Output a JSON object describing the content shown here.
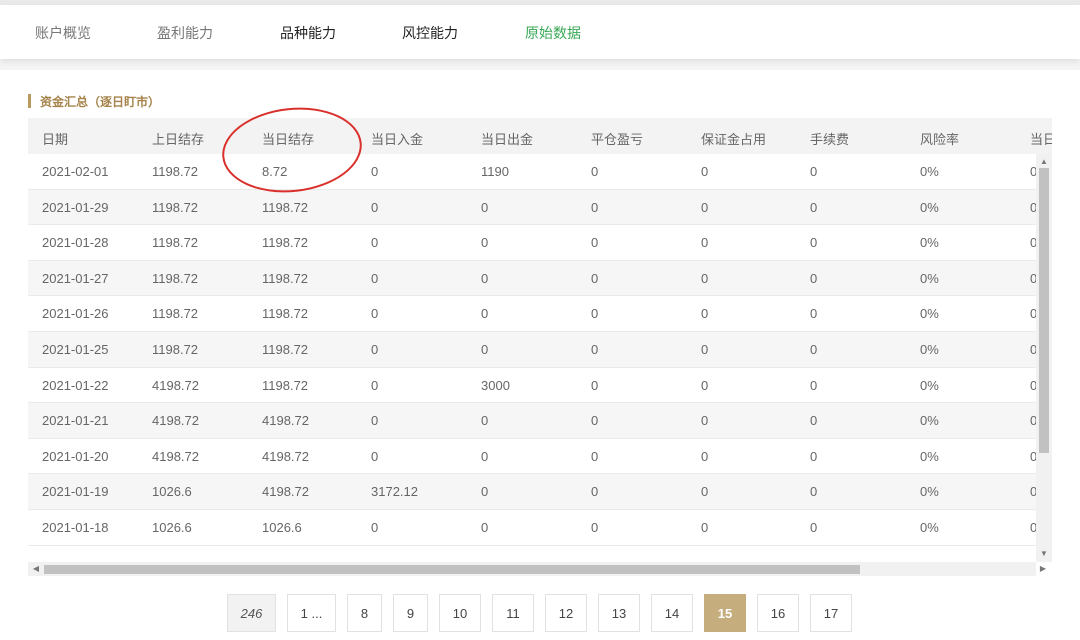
{
  "nav": {
    "tabs": [
      {
        "label": "账户概览",
        "state": "gray"
      },
      {
        "label": "盈利能力",
        "state": "gray"
      },
      {
        "label": "品种能力",
        "state": "dark"
      },
      {
        "label": "风控能力",
        "state": "dark"
      },
      {
        "label": "原始数据",
        "state": "active"
      }
    ]
  },
  "section": {
    "title": "资金汇总（逐日盯市）"
  },
  "table": {
    "headers": [
      "日期",
      "上日结存",
      "当日结存",
      "当日入金",
      "当日出金",
      "平仓盈亏",
      "保证金占用",
      "手续费",
      "风险率",
      "当日"
    ],
    "rows": [
      [
        "2021-02-01",
        "1198.72",
        "8.72",
        "0",
        "1190",
        "0",
        "0",
        "0",
        "0%",
        "0"
      ],
      [
        "2021-01-29",
        "1198.72",
        "1198.72",
        "0",
        "0",
        "0",
        "0",
        "0",
        "0%",
        "0"
      ],
      [
        "2021-01-28",
        "1198.72",
        "1198.72",
        "0",
        "0",
        "0",
        "0",
        "0",
        "0%",
        "0"
      ],
      [
        "2021-01-27",
        "1198.72",
        "1198.72",
        "0",
        "0",
        "0",
        "0",
        "0",
        "0%",
        "0"
      ],
      [
        "2021-01-26",
        "1198.72",
        "1198.72",
        "0",
        "0",
        "0",
        "0",
        "0",
        "0%",
        "0"
      ],
      [
        "2021-01-25",
        "1198.72",
        "1198.72",
        "0",
        "0",
        "0",
        "0",
        "0",
        "0%",
        "0"
      ],
      [
        "2021-01-22",
        "4198.72",
        "1198.72",
        "0",
        "3000",
        "0",
        "0",
        "0",
        "0%",
        "0"
      ],
      [
        "2021-01-21",
        "4198.72",
        "4198.72",
        "0",
        "0",
        "0",
        "0",
        "0",
        "0%",
        "0"
      ],
      [
        "2021-01-20",
        "4198.72",
        "4198.72",
        "0",
        "0",
        "0",
        "0",
        "0",
        "0%",
        "0"
      ],
      [
        "2021-01-19",
        "1026.6",
        "4198.72",
        "3172.12",
        "0",
        "0",
        "0",
        "0",
        "0%",
        "0"
      ],
      [
        "2021-01-18",
        "1026.6",
        "1026.6",
        "0",
        "0",
        "0",
        "0",
        "0",
        "0%",
        "0"
      ]
    ]
  },
  "pagination": {
    "total": "246",
    "pages": [
      "1 ...",
      "8",
      "9",
      "10",
      "11",
      "12",
      "13",
      "14",
      "15",
      "16",
      "17"
    ],
    "current": "15"
  },
  "colors": {
    "accent_gold": "#c5ad7e",
    "active_tab": "#3aa856",
    "annotation_red": "#d9302c"
  }
}
